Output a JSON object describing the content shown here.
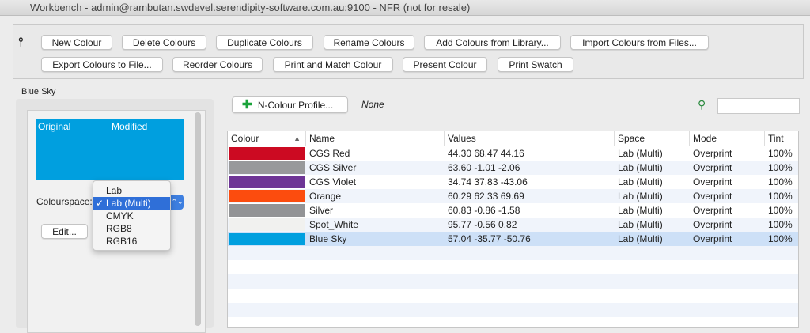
{
  "window": {
    "title": "Workbench - admin@rambutan.swdevel.serendipity-software.com.au:9100 - NFR (not for resale)"
  },
  "toolbar": {
    "row1": [
      "New Colour",
      "Delete Colours",
      "Duplicate Colours",
      "Rename Colours",
      "Add Colours from Library...",
      "Import Colours from Files..."
    ],
    "row2": [
      "Export Colours to File...",
      "Reorder Colours",
      "Print and Match Colour",
      "Present Colour",
      "Print Swatch"
    ]
  },
  "left": {
    "title": "Blue Sky",
    "original": "Original",
    "modified": "Modified",
    "swatch_color": "#009fdf",
    "colourspace_label": "Colourspace:",
    "colourspace_options": [
      "Lab",
      "Lab (Multi)",
      "CMYK",
      "RGB8",
      "RGB16"
    ],
    "selected": "Lab (Multi)",
    "check": "✓",
    "edit": "Edit..."
  },
  "right": {
    "profile_button": "N-Colour Profile...",
    "profile_value": "None",
    "search_value": ""
  },
  "table": {
    "headers": [
      "Colour",
      "Name",
      "Values",
      "Space",
      "Mode",
      "Tint"
    ],
    "rows": [
      {
        "color": "#cc0a22",
        "name": "CGS Red",
        "values": "44.30 68.47 44.16",
        "space": "Lab (Multi)",
        "mode": "Overprint",
        "tint": "100%"
      },
      {
        "color": "#98999b",
        "name": "CGS Silver",
        "values": "63.60 -1.01 -2.06",
        "space": "Lab (Multi)",
        "mode": "Overprint",
        "tint": "100%"
      },
      {
        "color": "#6e3596",
        "name": "CGS Violet",
        "values": "34.74 37.83 -43.06",
        "space": "Lab (Multi)",
        "mode": "Overprint",
        "tint": "100%"
      },
      {
        "color": "#fc4c0e",
        "name": "Orange",
        "values": "60.29 62.33 69.69",
        "space": "Lab (Multi)",
        "mode": "Overprint",
        "tint": "100%"
      },
      {
        "color": "#939496",
        "name": "Silver",
        "values": "60.83 -0.86 -1.58",
        "space": "Lab (Multi)",
        "mode": "Overprint",
        "tint": "100%"
      },
      {
        "color": "#f1f1ef",
        "name": "Spot_White",
        "values": "95.77 -0.56 0.82",
        "space": "Lab (Multi)",
        "mode": "Overprint",
        "tint": "100%"
      },
      {
        "color": "#009fdf",
        "name": "Blue Sky",
        "values": "57.04 -35.77 -50.76",
        "space": "Lab (Multi)",
        "mode": "Overprint",
        "tint": "100%"
      }
    ],
    "selected_index": 6
  }
}
